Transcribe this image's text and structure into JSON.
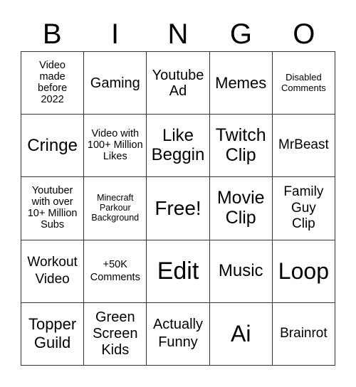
{
  "header": {
    "letters": [
      "B",
      "I",
      "N",
      "G",
      "O"
    ]
  },
  "board": {
    "cells": [
      "Video made before 2022",
      "Gaming",
      "Youtube Ad",
      "Memes",
      "Disabled Comments",
      "Cringe",
      "Video with 100+ Million Likes",
      "Like Beggin",
      "Twitch Clip",
      "MrBeast",
      "Youtuber with over 10+ Million Subs",
      "Minecraft Parkour Background",
      "Free!",
      "Movie Clip",
      "Family Guy Clip",
      "Workout Video",
      "+50K Comments",
      "Edit",
      "Music",
      "Loop",
      "Topper Guild",
      "Green Screen Kids",
      "Actually Funny",
      "Ai",
      "Brainrot"
    ]
  }
}
